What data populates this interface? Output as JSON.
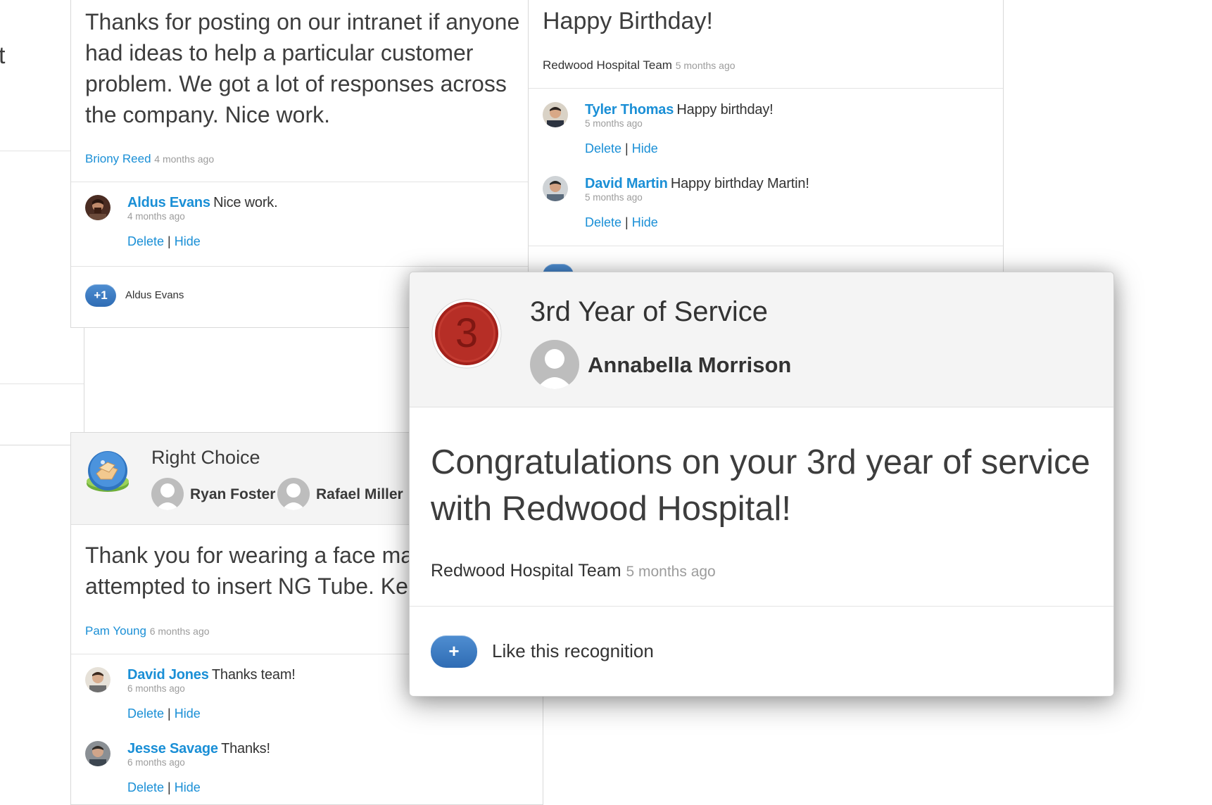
{
  "colors": {
    "link": "#1a8fd6",
    "muted": "#9c9c9c",
    "pill_blue": "#3a7bc8",
    "medal_red": "#b82f28"
  },
  "left_fragment": {
    "text": "t"
  },
  "card_intranet": {
    "body": "Thanks for posting on our intranet if anyone had ideas to help a particular customer problem. We got a lot of responses across the company. Nice work.",
    "author": "Briony Reed",
    "time": "4 months ago",
    "comments": [
      {
        "name": "Aldus Evans",
        "text": "Nice work.",
        "time": "4 months ago",
        "delete": "Delete",
        "sep": "|",
        "hide": "Hide"
      }
    ],
    "plus_label": "+1",
    "plus_by": "Aldus Evans"
  },
  "card_birthday": {
    "title": "Happy Birthday!",
    "author": "Redwood Hospital Team",
    "time": "5 months ago",
    "comments": [
      {
        "name": "Tyler Thomas",
        "text": "Happy birthday!",
        "time": "5 months ago",
        "delete": "Delete",
        "sep": "|",
        "hide": "Hide"
      },
      {
        "name": "David Martin",
        "text": "Happy birthday Martin!",
        "time": "5 months ago",
        "delete": "Delete",
        "sep": "|",
        "hide": "Hide"
      }
    ]
  },
  "card_right_choice": {
    "title": "Right Choice",
    "badge_icon": "hands-badge-icon",
    "recipients": [
      "Ryan Foster",
      "Rafael Miller"
    ],
    "body_line1": "Thank you for wearing a face mas",
    "body_line2": "attempted to insert NG Tube.  Ke",
    "author": "Pam Young",
    "time": "6 months ago",
    "comments": [
      {
        "name": "David Jones",
        "text": "Thanks team!",
        "time": "6 months ago",
        "delete": "Delete",
        "sep": "|",
        "hide": "Hide"
      },
      {
        "name": "Jesse Savage",
        "text": "Thanks!",
        "time": "6 months ago",
        "delete": "Delete",
        "sep": "|",
        "hide": "Hide"
      }
    ]
  },
  "modal": {
    "medal_number": "3",
    "title": "3rd Year of Service",
    "recipient": "Annabella Morrison",
    "message": "Congratulations on your 3rd year of service with Redwood Hospital!",
    "author": "Redwood Hospital Team",
    "time": "5 months ago",
    "like_button": "+",
    "like_label": "Like this recognition"
  }
}
